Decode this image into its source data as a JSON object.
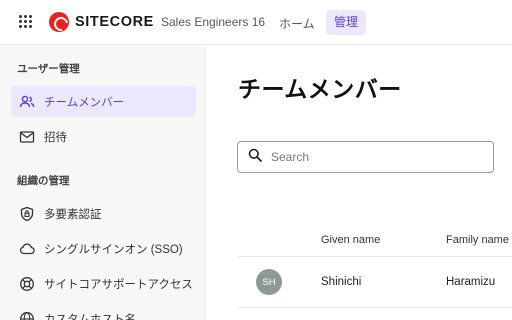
{
  "header": {
    "logo_text": "SITECORE",
    "org_name": "Sales Engineers 16",
    "nav": {
      "home": "ホーム",
      "admin": "管理"
    },
    "icons": {
      "app_switcher": "grid-icon",
      "logo": "sitecore-logo-icon"
    }
  },
  "sidebar": {
    "section_user": "ユーザー管理",
    "user_items": [
      {
        "label": "チームメンバー",
        "icon": "people-icon",
        "active": true
      },
      {
        "label": "招待",
        "icon": "mail-icon",
        "active": false
      }
    ],
    "section_org": "組織の管理",
    "org_items": [
      {
        "label": "多要素認証",
        "icon": "shield-icon"
      },
      {
        "label": "シングルサインオン (SSO)",
        "icon": "cloud-icon"
      },
      {
        "label": "サイトコアサポートアクセス",
        "icon": "lifebuoy-icon"
      },
      {
        "label": "カスタムホスト名",
        "icon": "globe-icon"
      }
    ]
  },
  "main": {
    "title": "チームメンバー",
    "search": {
      "placeholder": "Search",
      "value": ""
    },
    "table": {
      "columns": [
        "",
        "Given name",
        "Family name"
      ],
      "rows": [
        {
          "initials": "SH",
          "given_name": "Shinichi",
          "family_name": "Haramizu"
        }
      ]
    }
  },
  "colors": {
    "accent": "#5b3fd1",
    "accent_bg": "#ece8fc",
    "brand_red": "#eb1f1f",
    "avatar": "#8d9a92"
  }
}
